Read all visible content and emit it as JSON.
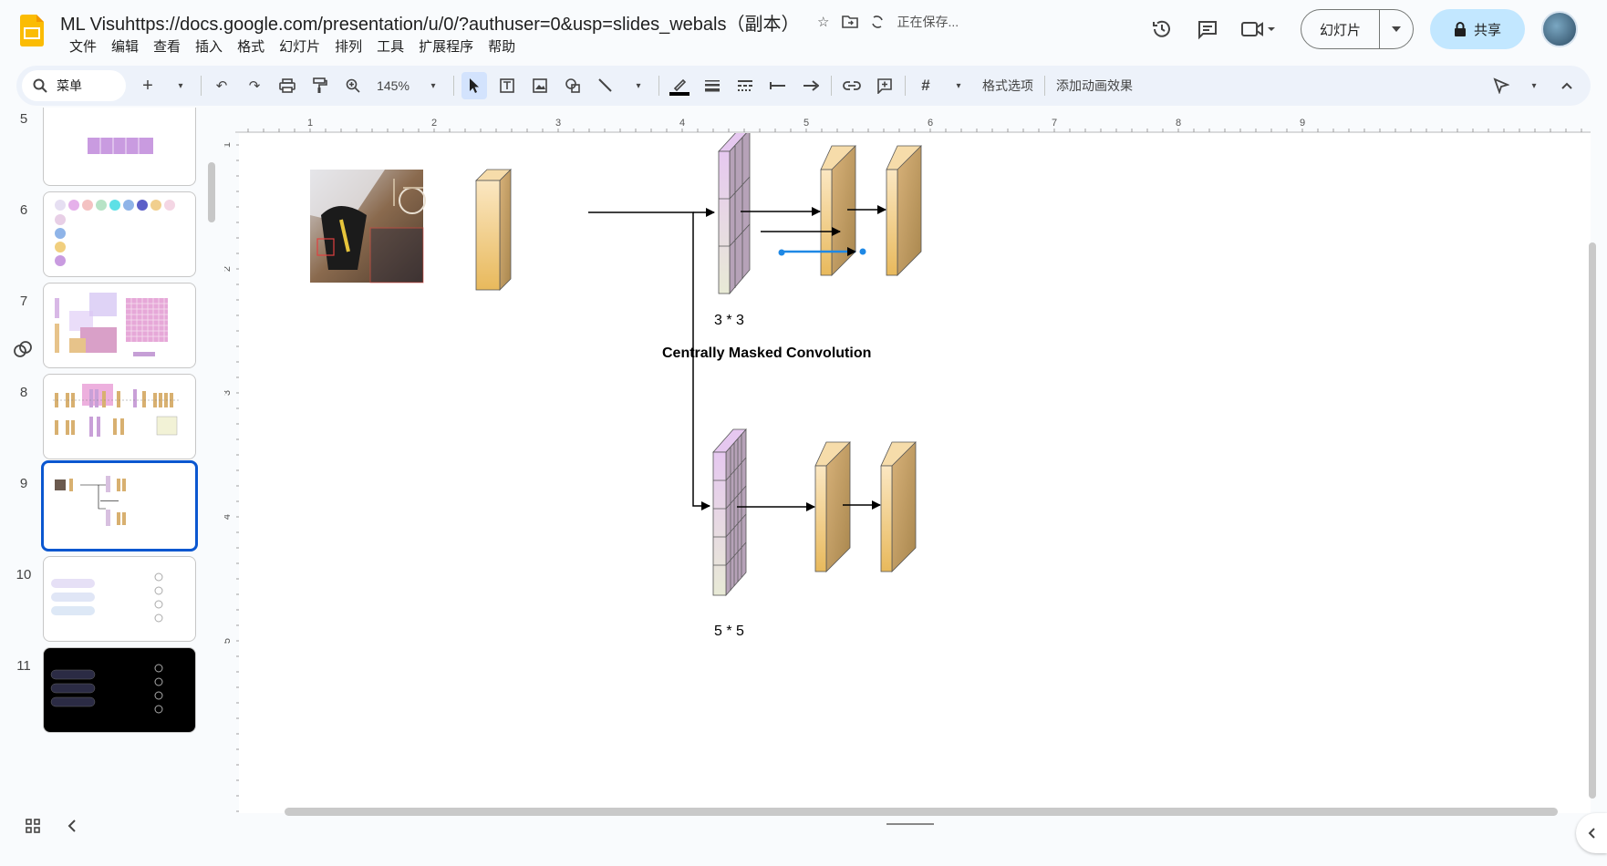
{
  "doc": {
    "title": "ML Visuhttps://docs.google.com/presentation/u/0/?authuser=0&usp=slides_webals（副本）",
    "saving": "正在保存..."
  },
  "menu": [
    "文件",
    "编辑",
    "查看",
    "插入",
    "格式",
    "幻灯片",
    "排列",
    "工具",
    "扩展程序",
    "帮助"
  ],
  "header_right": {
    "slideshow_label": "幻灯片",
    "share_label": "共享"
  },
  "toolbar": {
    "search_label": "菜单",
    "zoom": "145%",
    "format_options": "格式选项",
    "add_animation": "添加动画效果"
  },
  "slides": [
    {
      "num": "5"
    },
    {
      "num": "6"
    },
    {
      "num": "7"
    },
    {
      "num": "8"
    },
    {
      "num": "9",
      "selected": true
    },
    {
      "num": "10"
    },
    {
      "num": "11"
    }
  ],
  "ruler": {
    "h_labels": [
      "1",
      "2",
      "3",
      "4",
      "5",
      "6",
      "7",
      "8",
      "9"
    ],
    "v_labels": [
      "1",
      "2",
      "3",
      "4",
      "5"
    ]
  },
  "diagram": {
    "label_3x3": "3 * 3",
    "caption": "Centrally Masked Convolution",
    "label_5x5": "5 * 5"
  },
  "colors": {
    "accent": "#0b57d0",
    "share_bg": "#c2e7ff",
    "toolbar_bg": "#edf2fa",
    "block_tan": "#e9c98c",
    "block_purple": "#dcc3e6",
    "connector_blue": "#1e88e5"
  }
}
